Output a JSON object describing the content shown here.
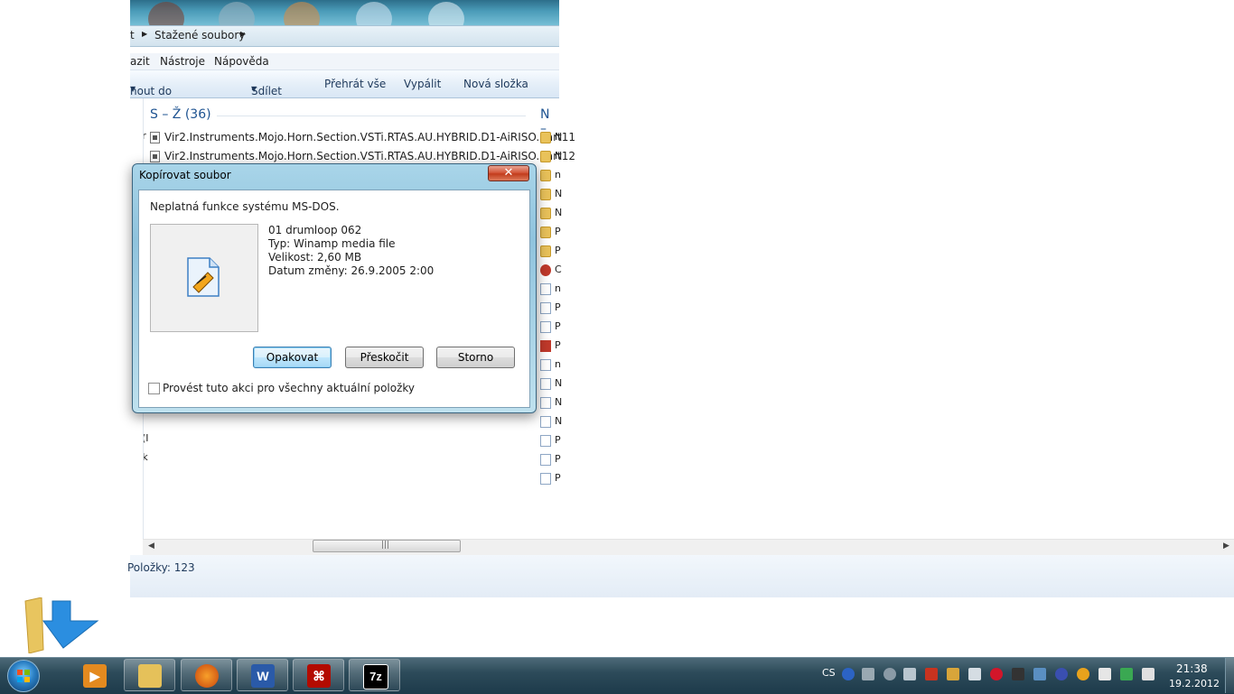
{
  "address": {
    "crumb_partial": "t",
    "crumb": "Stažené soubory"
  },
  "menu": {
    "items": [
      "azit",
      "Nástroje",
      "Nápověda"
    ]
  },
  "toolbar": {
    "include_library": "nout do knihovny",
    "share": "Sdílet s",
    "play_all": "Přehrát vše",
    "burn": "Vypálit",
    "new_folder": "Nová složka"
  },
  "groups": {
    "s_z_header": "S – Ž (36)",
    "n_header": "N –"
  },
  "files": [
    "Vir2.Instruments.Mojo.Horn.Section.VSTi.RTAS.AU.HYBRID.D1-AiRISO.part11",
    "Vir2.Instruments.Mojo.Horn.Section.VSTi.RTAS.AU.HYBRID.D1-AiRISO.part12"
  ],
  "left_fragments": [
    "ver",
    "M (I",
    "Klik"
  ],
  "right_letters": [
    "N",
    "N",
    "n",
    "N",
    "N",
    "P",
    "P",
    "C",
    "n",
    "P",
    "P",
    "P",
    "n",
    "N",
    "N",
    "N",
    "P",
    "P",
    "P"
  ],
  "status": {
    "items": "Položky: 123"
  },
  "dialog": {
    "title": "Kopírovat soubor",
    "close_symbol": "✕",
    "message": "Neplatná funkce systému MS-DOS.",
    "file_name": "01 drumloop 062",
    "file_type": "Typ: Winamp media file",
    "file_size": "Velikost: 2,60 MB",
    "file_date": "Datum změny: 26.9.2005 2:00",
    "retry": "Opakovat",
    "skip": "Přeskočit",
    "cancel": "Storno",
    "apply_all": "Provést tuto akci pro všechny aktuální položky"
  },
  "taskbar": {
    "lang": "CS",
    "time": "21:38",
    "date": "19.2.2012",
    "word_glyph": "W",
    "sevenzip_glyph": "7z"
  },
  "colors": {
    "accent": "#1e5391",
    "taskbar": "#2d4b5a",
    "close": "#c23c1c"
  }
}
